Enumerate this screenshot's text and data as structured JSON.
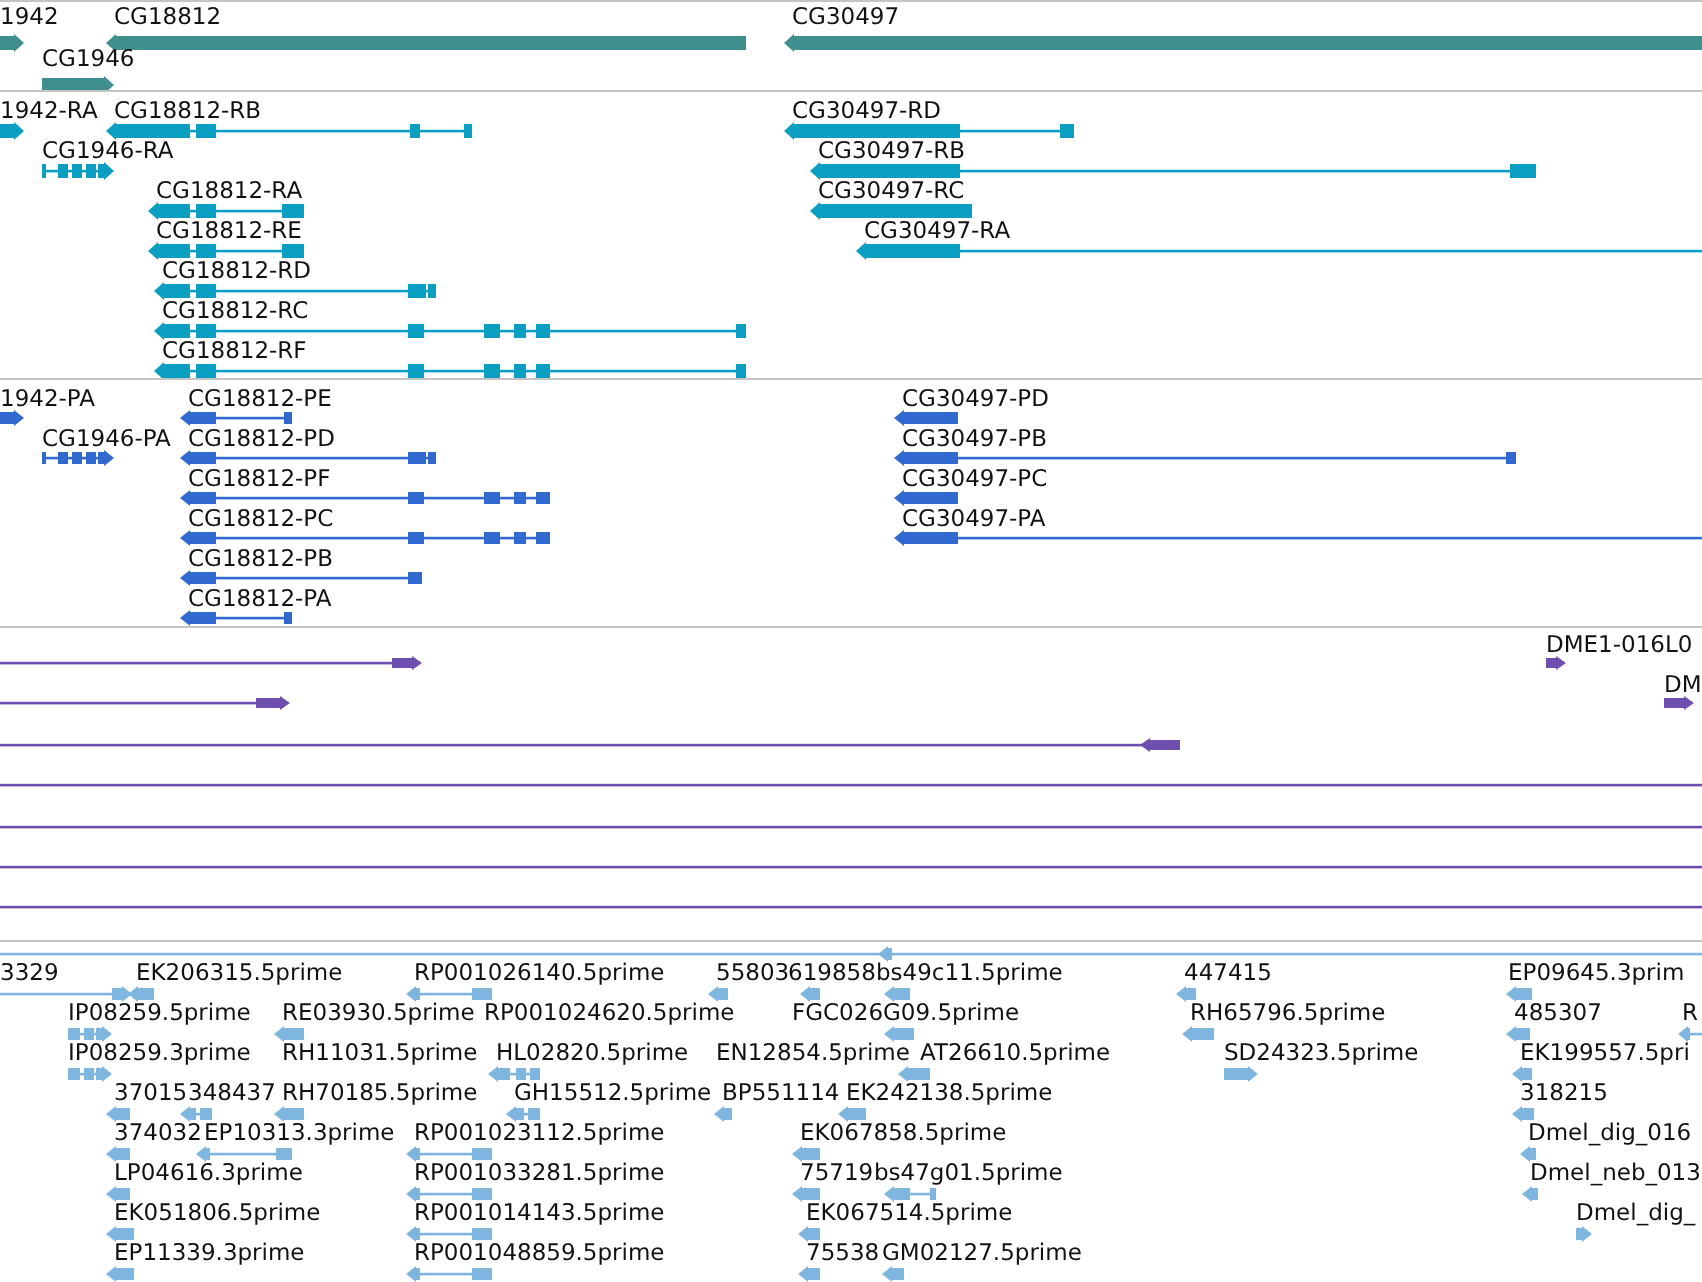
{
  "tracks": [
    {
      "features": [
        {
          "label": "1942",
          "reverse": false
        },
        {
          "label": "CG18812",
          "reverse": true
        },
        {
          "label": "CG30497",
          "reverse": true
        },
        {
          "label": "CG1946",
          "reverse": false
        }
      ]
    },
    {
      "features": [
        {
          "label": "1942-RA",
          "reverse": false
        },
        {
          "label": "CG18812-RB",
          "reverse": true
        },
        {
          "label": "CG30497-RD",
          "reverse": true
        },
        {
          "label": "CG1946-RA",
          "reverse": false
        },
        {
          "label": "CG30497-RB",
          "reverse": true
        },
        {
          "label": "CG18812-RA",
          "reverse": true
        },
        {
          "label": "CG30497-RC",
          "reverse": true
        },
        {
          "label": "CG18812-RE",
          "reverse": true
        },
        {
          "label": "CG30497-RA",
          "reverse": true
        },
        {
          "label": "CG18812-RD",
          "reverse": true
        },
        {
          "label": "CG18812-RC",
          "reverse": true
        },
        {
          "label": "CG18812-RF",
          "reverse": true
        }
      ]
    },
    {
      "features": [
        {
          "label": "1942-PA",
          "reverse": false
        },
        {
          "label": "CG18812-PE",
          "reverse": true
        },
        {
          "label": "CG30497-PD",
          "reverse": true
        },
        {
          "label": "CG1946-PA",
          "reverse": false
        },
        {
          "label": "CG18812-PD",
          "reverse": true
        },
        {
          "label": "CG30497-PB",
          "reverse": true
        },
        {
          "label": "CG18812-PF",
          "reverse": true
        },
        {
          "label": "CG30497-PC",
          "reverse": true
        },
        {
          "label": "CG18812-PC",
          "reverse": true
        },
        {
          "label": "CG30497-PA",
          "reverse": true
        },
        {
          "label": "CG18812-PB",
          "reverse": true
        },
        {
          "label": "CG18812-PA",
          "reverse": true
        }
      ]
    },
    {
      "features": [
        {
          "kind": "arrow",
          "reverse": false
        },
        {
          "kind": "arrow",
          "label": "DME1-016L0",
          "reverse": false
        },
        {
          "kind": "arrow",
          "reverse": false
        },
        {
          "kind": "arrow",
          "label": "DM",
          "reverse": false
        },
        {
          "kind": "arrow",
          "reverse": true
        },
        {
          "kind": "line"
        },
        {
          "kind": "line"
        },
        {
          "kind": "line"
        },
        {
          "kind": "line"
        }
      ]
    },
    {
      "features": [
        {
          "reverse": true
        },
        {
          "label": "3329",
          "reverse": false
        },
        {
          "label": "EK206315.5prime",
          "reverse": true
        },
        {
          "label": "RP001026140.5prime",
          "reverse": true
        },
        {
          "label": "55803",
          "reverse": true
        },
        {
          "label": "619858",
          "reverse": true
        },
        {
          "label": "bs49c11.5prime",
          "reverse": true
        },
        {
          "label": "447415",
          "reverse": true
        },
        {
          "label": "EP09645.3prim",
          "reverse": true
        },
        {
          "label": "IP08259.5prime",
          "reverse": false
        },
        {
          "label": "RE03930.5prime",
          "reverse": true
        },
        {
          "label": "RP001024620.5prime"
        },
        {
          "label": "FGC026G09.5prime",
          "reverse": true
        },
        {
          "label": "RH65796.5prime",
          "reverse": true
        },
        {
          "label": "485307",
          "reverse": true
        },
        {
          "label": "R",
          "reverse": true
        },
        {
          "label": "IP08259.3prime",
          "reverse": false
        },
        {
          "label": "RH11031.5prime"
        },
        {
          "label": "HL02820.5prime",
          "reverse": true
        },
        {
          "label": "EN12854.5prime"
        },
        {
          "label": "AT26610.5prime",
          "reverse": true
        },
        {
          "label": "SD24323.5prime",
          "reverse": false
        },
        {
          "label": "EK199557.5pri",
          "reverse": true
        },
        {
          "label": "37015",
          "reverse": true
        },
        {
          "label": "348437",
          "reverse": true
        },
        {
          "label": "RH70185.5prime",
          "reverse": true
        },
        {
          "label": "GH15512.5prime",
          "reverse": true
        },
        {
          "label": "BP551114",
          "reverse": true
        },
        {
          "label": "EK242138.5prime",
          "reverse": true
        },
        {
          "label": "318215",
          "reverse": true
        },
        {
          "label": "374032",
          "reverse": true
        },
        {
          "label": "EP10313.3prime",
          "reverse": true
        },
        {
          "label": "RP001023112.5prime",
          "reverse": true
        },
        {
          "label": "EK067858.5prime",
          "reverse": true
        },
        {
          "label": "Dmel_dig_016",
          "reverse": true
        },
        {
          "label": "LP04616.3prime",
          "reverse": true
        },
        {
          "label": "RP001033281.5prime",
          "reverse": true
        },
        {
          "label": "75719",
          "reverse": true
        },
        {
          "label": "bs47g01.5prime",
          "reverse": true
        },
        {
          "label": "Dmel_neb_013",
          "reverse": true
        },
        {
          "label": "EK051806.5prime",
          "reverse": true
        },
        {
          "label": "RP001014143.5prime",
          "reverse": true
        },
        {
          "label": "EK067514.5prime",
          "reverse": true
        },
        {
          "label": "Dmel_dig_",
          "reverse": false
        },
        {
          "label": "EP11339.3prime",
          "reverse": true
        },
        {
          "label": "RP001048859.5prime",
          "reverse": true
        },
        {
          "label": "75538",
          "reverse": true
        },
        {
          "label": "GM02127.5prime",
          "reverse": true
        }
      ]
    }
  ]
}
